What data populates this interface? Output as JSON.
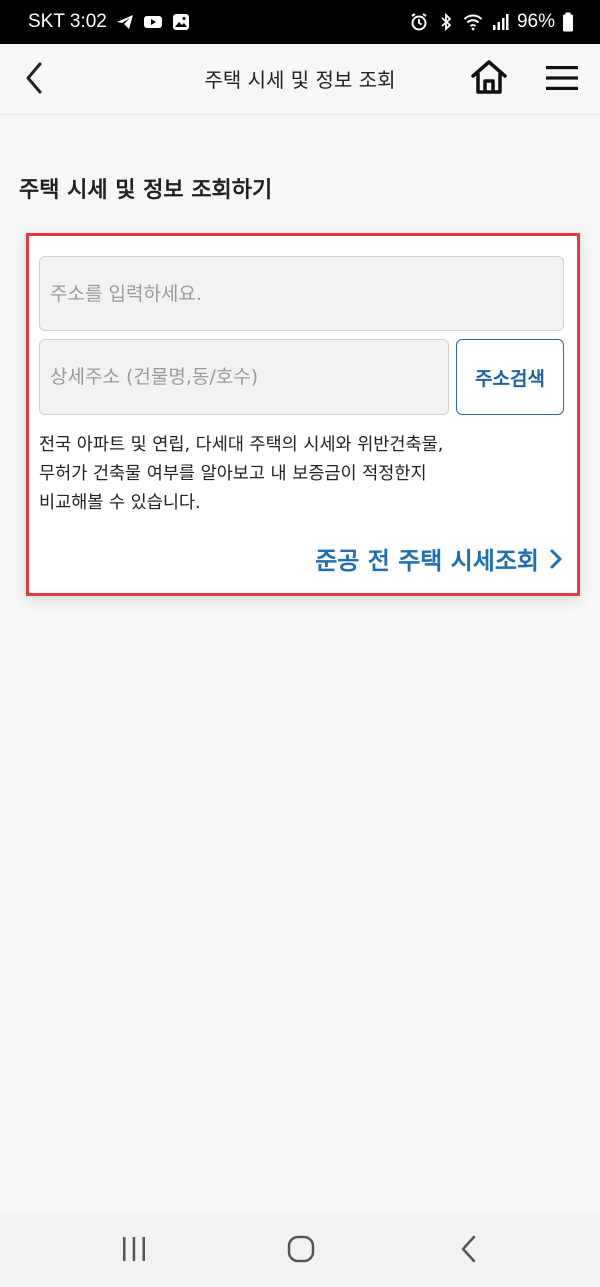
{
  "status_bar": {
    "carrier_time": "SKT 3:02",
    "battery": "96%"
  },
  "app_bar": {
    "title": "주택 시세 및 정보 조회"
  },
  "page": {
    "heading": "주택 시세 및 정보 조회하기"
  },
  "form": {
    "address_placeholder": "주소를 입력하세요.",
    "detail_placeholder": "상세주소 (건물명,동/호수)",
    "search_label": "주소검색",
    "description": "전국 아파트 및 연립, 다세대 주택의 시세와 위반건축물,\n무허가 건축물 여부를 알아보고 내 보증금이 적정한지\n비교해볼 수 있습니다.",
    "link_label": "준공 전 주택 시세조회"
  },
  "colors": {
    "accent_blue": "#1e6fb3",
    "highlight_red": "#e53940"
  }
}
